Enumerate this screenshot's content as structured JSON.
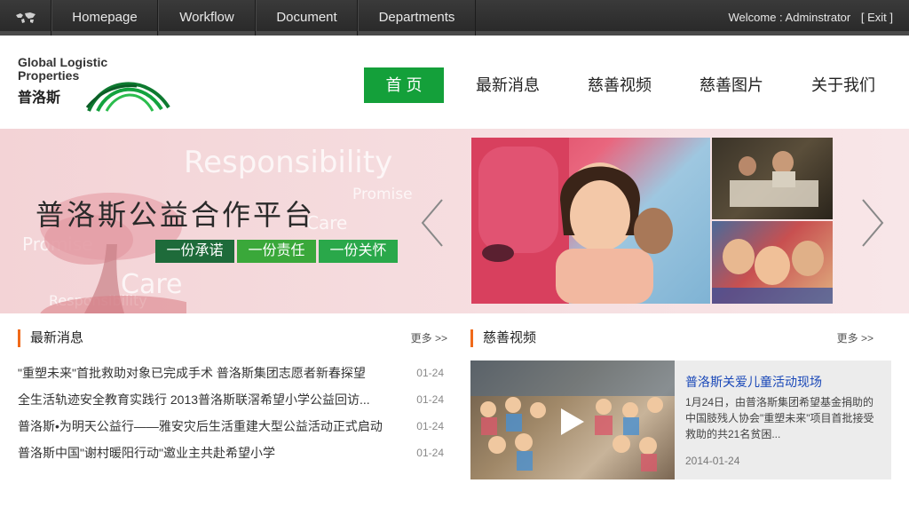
{
  "topbar": {
    "nav": [
      {
        "label": "Homepage"
      },
      {
        "label": "Workflow"
      },
      {
        "label": "Document"
      },
      {
        "label": "Departments"
      }
    ],
    "welcome_label": "Welcome : Adminstrator",
    "exit_label": "[ Exit ]"
  },
  "logo": {
    "line1": "Global Logistic",
    "line2": "Properties",
    "line3": "普洛斯"
  },
  "mainnav": [
    {
      "label": "首 页",
      "active": true
    },
    {
      "label": "最新消息"
    },
    {
      "label": "慈善视频"
    },
    {
      "label": "慈善图片"
    },
    {
      "label": "关于我们"
    }
  ],
  "banner": {
    "title": "普洛斯公益合作平台",
    "bg_words": [
      "Responsibility",
      "Promise",
      "Care",
      "Promise",
      "Care",
      "Responsibility"
    ],
    "tags": [
      {
        "label": "一份承诺",
        "color": "#1e6b3a"
      },
      {
        "label": "一份责任",
        "color": "#3aa83a"
      },
      {
        "label": "一份关怀",
        "color": "#2aa84a"
      }
    ]
  },
  "news": {
    "title": "最新消息",
    "more": "更多 >>",
    "items": [
      {
        "title": "\"重塑未来\"首批救助对象已完成手术 普洛斯集团志愿者新春探望",
        "date": "01-24"
      },
      {
        "title": "全生活轨迹安全教育实践行 2013普洛斯联滘希望小学公益回访...",
        "date": "01-24"
      },
      {
        "title": "普洛斯•为明天公益行——雅安灾后生活重建大型公益活动正式启动",
        "date": "01-24"
      },
      {
        "title": "普洛斯中国\"谢村暖阳行动\"邀业主共赴希望小学",
        "date": "01-24"
      }
    ]
  },
  "videos": {
    "title": "慈善视频",
    "more": "更多 >>",
    "card": {
      "title": "普洛斯关爱儿童活动现场",
      "desc": "1月24日，由普洛斯集团希望基金捐助的中国肢残人协会\"重塑未来\"项目首批接受救助的共21名贫困...",
      "date": "2014-01-24"
    }
  },
  "colors": {
    "accent_green": "#14a03a",
    "section_bar": "#f06a1a",
    "link_blue": "#1a48b8"
  }
}
